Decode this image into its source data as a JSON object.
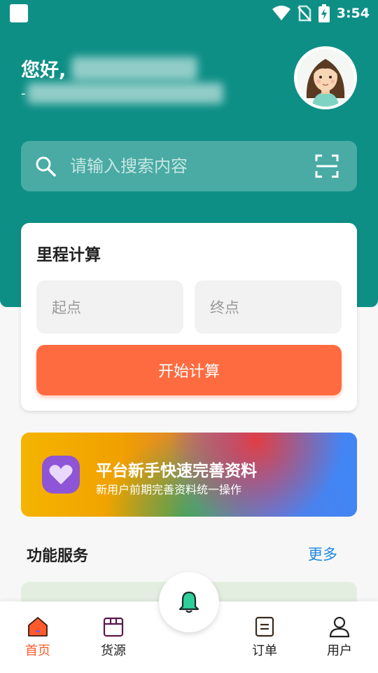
{
  "status_bar": {
    "time": "3:54",
    "icons": [
      "wifi-icon",
      "no-sim-icon",
      "battery-charging-icon"
    ]
  },
  "header": {
    "greeting": "您好,",
    "subline_prefix": "-",
    "avatar": "avatar-girl"
  },
  "search": {
    "placeholder": "请输入搜索内容",
    "icon": "search-icon",
    "scan_icon": "scan-icon"
  },
  "mileage": {
    "title": "里程计算",
    "start_placeholder": "起点",
    "end_placeholder": "终点",
    "button_label": "开始计算"
  },
  "banner": {
    "title": "平台新手快速完善资料",
    "subtitle": "新用户前期完善资料统一操作",
    "icon": "heart-icon"
  },
  "services": {
    "title": "功能服务",
    "more_label": "更多"
  },
  "bottom_nav": {
    "items": [
      {
        "label": "首页",
        "icon": "home-icon",
        "active": true
      },
      {
        "label": "货源",
        "icon": "cargo-icon",
        "active": false
      },
      {
        "label": "订单",
        "icon": "order-icon",
        "active": false
      },
      {
        "label": "用户",
        "icon": "user-icon",
        "active": false
      }
    ],
    "center_icon": "bell-icon"
  },
  "colors": {
    "primary": "#0d8f86",
    "accent": "#ff6b40",
    "link": "#1e88e5",
    "active_nav": "#ff5a2c"
  }
}
